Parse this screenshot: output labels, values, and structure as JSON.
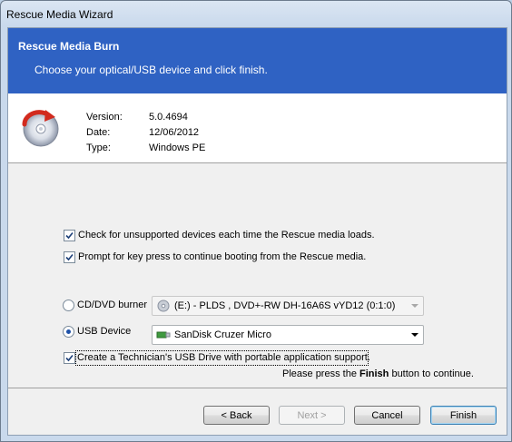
{
  "window": {
    "title": "Rescue Media Wizard"
  },
  "banner": {
    "title": "Rescue Media Burn",
    "subtitle": "Choose your optical/USB device and click finish."
  },
  "info": {
    "icon": "disc-arrow-icon",
    "rows": [
      {
        "key": "Version:",
        "value": "5.0.4694"
      },
      {
        "key": "Date:",
        "value": "12/06/2012"
      },
      {
        "key": "Type:",
        "value": "Windows PE"
      }
    ]
  },
  "options": {
    "check_unsupported": {
      "label": "Check for unsupported devices each time the Rescue media loads.",
      "checked": true
    },
    "prompt_key": {
      "label": "Prompt for key press to continue booting from the Rescue media.",
      "checked": true
    },
    "cd_dvd": {
      "label": "CD/DVD burner",
      "selected": false,
      "device": "(E:) - PLDS     , DVD+-RW DH-16A6S vYD12 (0:1:0)",
      "icon": "optical-drive-icon"
    },
    "usb": {
      "label": "USB Device",
      "selected": true,
      "device": "SanDisk Cruzer Micro",
      "icon": "usb-drive-icon"
    },
    "technician": {
      "label": "Create a Technician's USB Drive with portable application support.",
      "checked": true
    },
    "hint_prefix": "Please press the ",
    "hint_bold": "Finish",
    "hint_suffix": " button to continue."
  },
  "buttons": {
    "back": "< Back",
    "next": "Next >",
    "cancel": "Cancel",
    "finish": "Finish"
  },
  "colors": {
    "banner": "#2f62c3",
    "accent": "#1f52a8"
  }
}
